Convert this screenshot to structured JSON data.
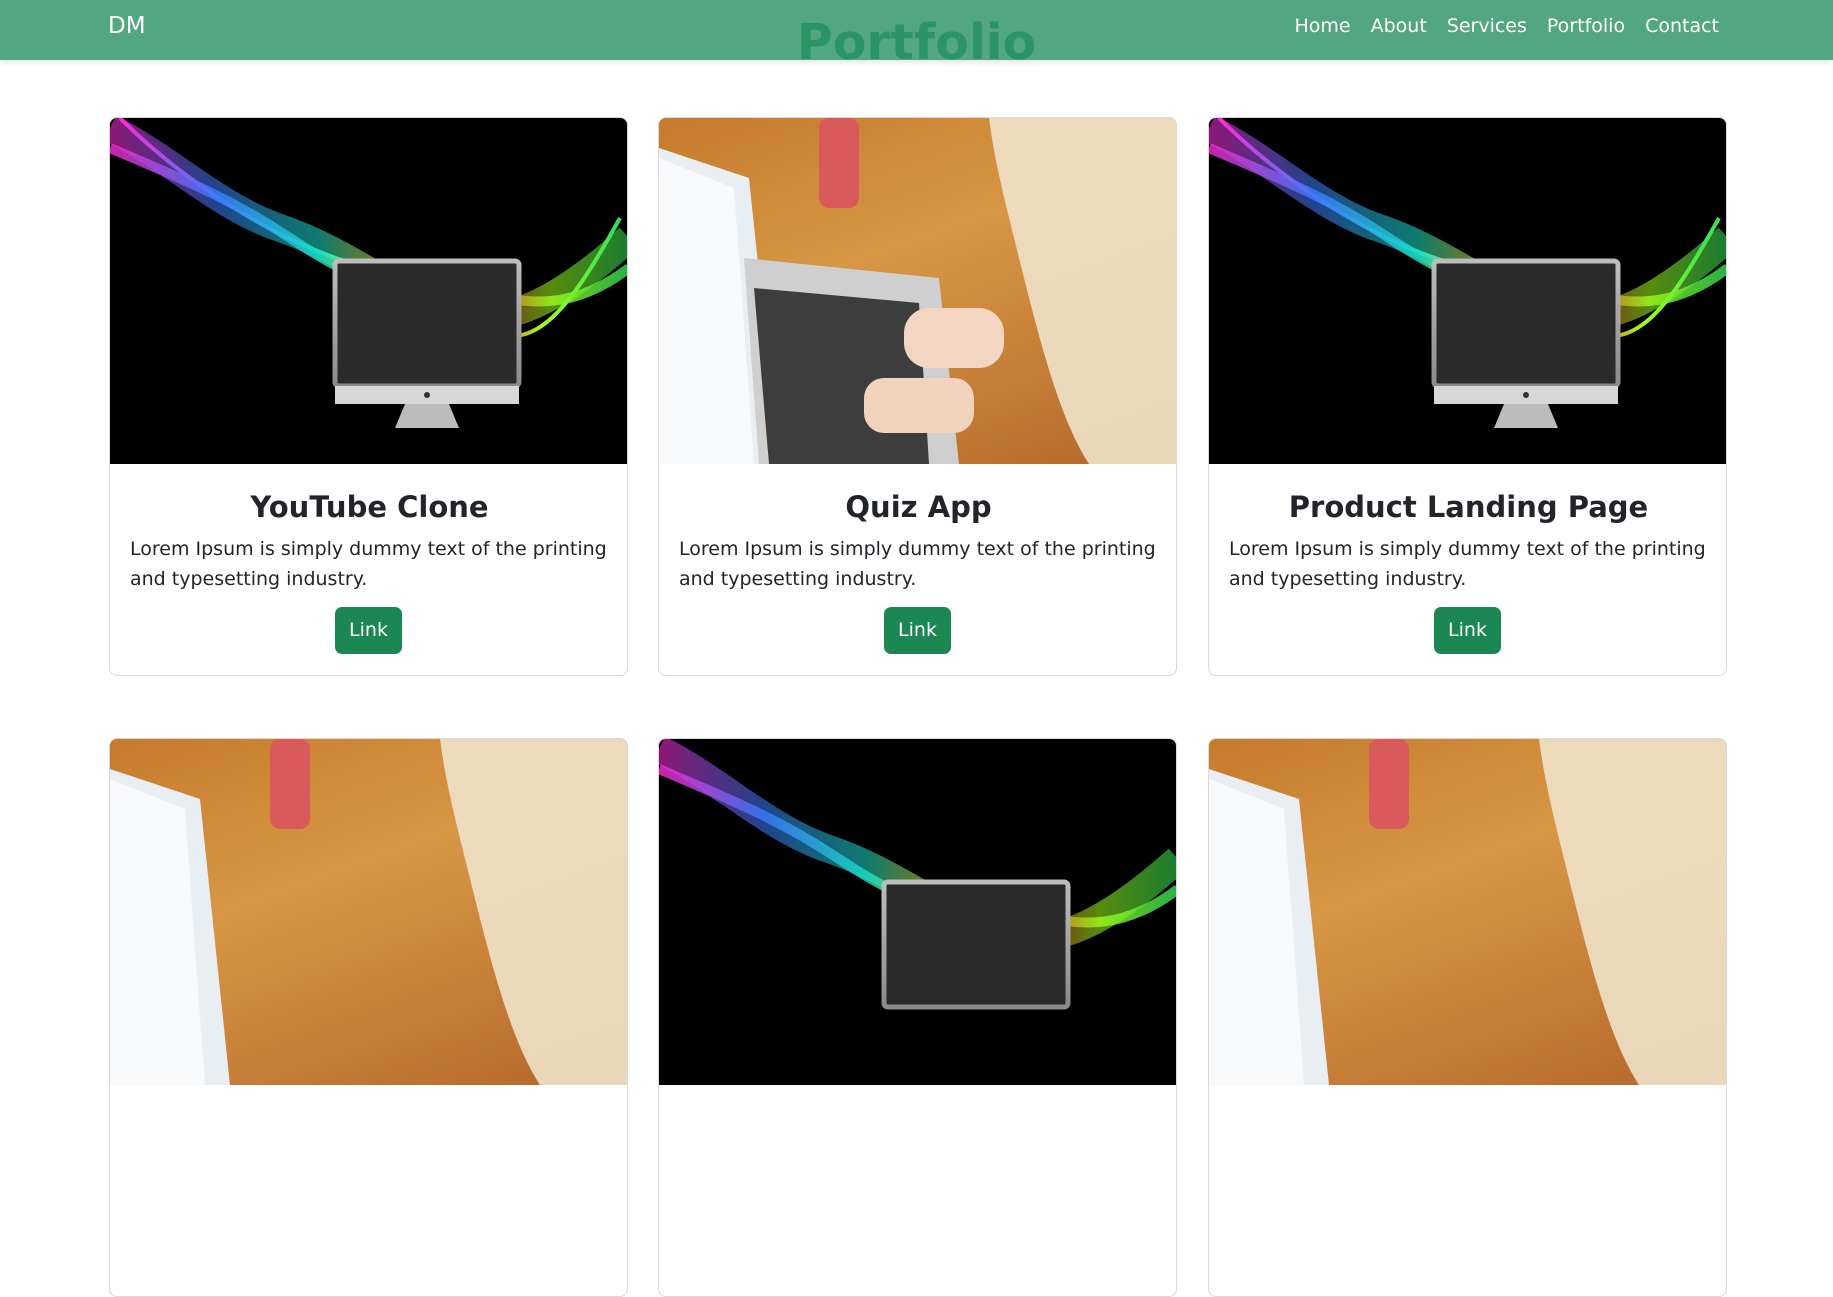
{
  "navbar": {
    "brand": "DM",
    "links": [
      "Home",
      "About",
      "Services",
      "Portfolio",
      "Contact"
    ]
  },
  "page": {
    "title": "Portfolio"
  },
  "cards": [
    {
      "title": "YouTube Clone",
      "text": "Lorem Ipsum is simply dummy text of the printing and typesetting industry.",
      "button": "Link",
      "image": "smoke"
    },
    {
      "title": "Quiz App",
      "text": "Lorem Ipsum is simply dummy text of the printing and typesetting industry.",
      "button": "Link",
      "image": "desk"
    },
    {
      "title": "Product Landing Page",
      "text": "Lorem Ipsum is simply dummy text of the printing and typesetting industry.",
      "button": "Link",
      "image": "smoke"
    },
    {
      "image": "desk"
    },
    {
      "image": "smoke"
    },
    {
      "image": "desk"
    }
  ],
  "colors": {
    "navbar": "#53a682",
    "title": "#2b9467",
    "button": "#1b8753"
  }
}
